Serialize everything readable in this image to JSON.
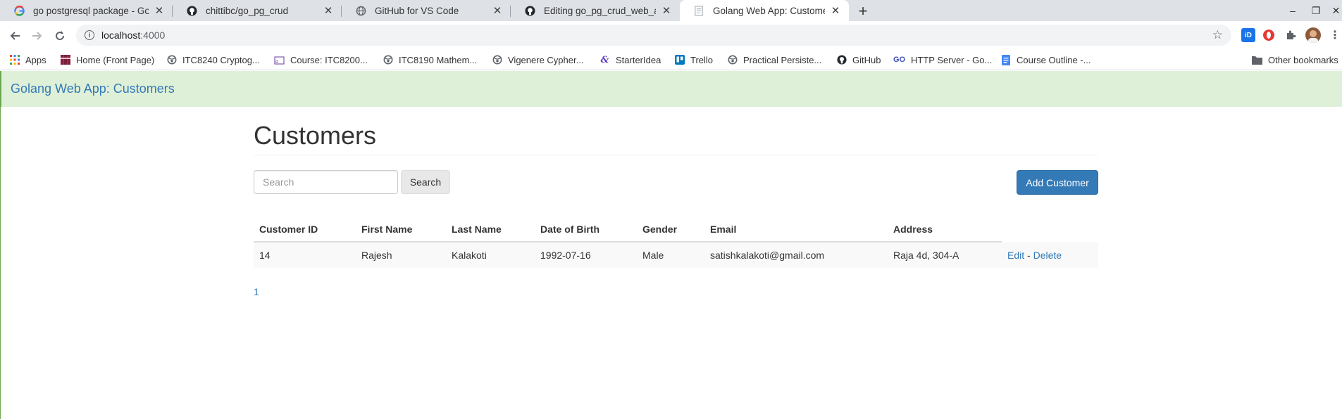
{
  "browser": {
    "tabs": [
      {
        "title": "go postgresql package - Goo",
        "icon": "google-icon"
      },
      {
        "title": "chittibc/go_pg_crud",
        "icon": "github-icon"
      },
      {
        "title": "GitHub for VS Code",
        "icon": "globe-icon"
      },
      {
        "title": "Editing go_pg_crud_web_app",
        "icon": "github-icon"
      },
      {
        "title": "Golang Web App: Customers",
        "icon": "page-icon",
        "active": true
      }
    ],
    "url": {
      "host": "localhost",
      "port": ":4000"
    },
    "bookmarks": [
      {
        "label": "Apps",
        "icon": "apps-grid-icon"
      },
      {
        "label": "Home (Front Page)",
        "icon": "tartan-icon"
      },
      {
        "label": "ITC8240 Cryptog...",
        "icon": "globe-icon"
      },
      {
        "label": "Course: ITC8200...",
        "icon": "course-icon"
      },
      {
        "label": "ITC8190 Mathem...",
        "icon": "globe-icon"
      },
      {
        "label": "Vigenere Cypher...",
        "icon": "globe-icon"
      },
      {
        "label": "StarterIdea",
        "icon": "script-icon"
      },
      {
        "label": "Trello",
        "icon": "trello-icon"
      },
      {
        "label": "Practical Persiste...",
        "icon": "globe-icon"
      },
      {
        "label": "GitHub",
        "icon": "github-icon"
      },
      {
        "label": "HTTP Server - Go...",
        "icon": "go-icon"
      },
      {
        "label": "Course Outline -...",
        "icon": "doc-icon"
      },
      {
        "label": "Other bookmarks",
        "icon": "folder-icon"
      }
    ]
  },
  "app": {
    "brand": "Golang Web App: Customers",
    "page_title": "Customers",
    "search": {
      "placeholder": "Search",
      "button": "Search"
    },
    "add_button": "Add Customer",
    "table": {
      "headers": [
        "Customer ID",
        "First Name",
        "Last Name",
        "Date of Birth",
        "Gender",
        "Email",
        "Address",
        ""
      ],
      "rows": [
        {
          "id": "14",
          "first_name": "Rajesh",
          "last_name": "Kalakoti",
          "dob": "1992-07-16",
          "gender": "Male",
          "email": "satishkalakoti@gmail.com",
          "address": "Raja 4d, 304-A",
          "edit": "Edit",
          "sep": " - ",
          "delete": "Delete"
        }
      ]
    },
    "pagination": [
      "1"
    ]
  }
}
